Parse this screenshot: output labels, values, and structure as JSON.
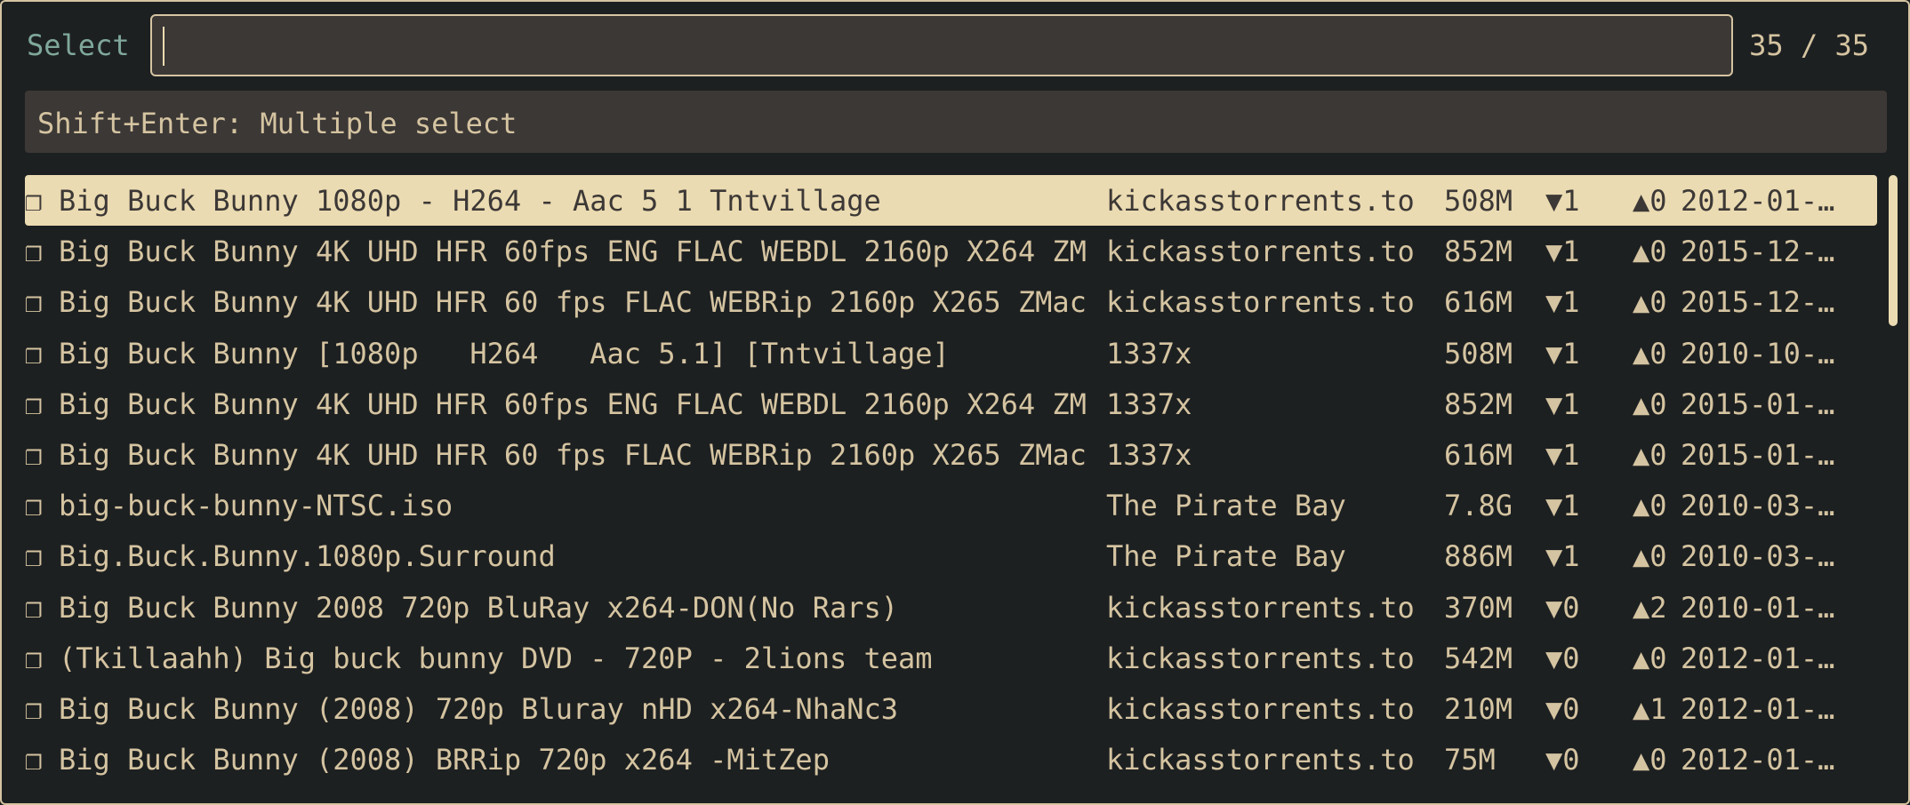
{
  "prompt": {
    "label": "Select",
    "value": "",
    "count": "35 / 35"
  },
  "header": {
    "text": "Shift+Enter: Multiple select"
  },
  "results": [
    {
      "check": "❐",
      "title": "Big Buck Bunny 1080p - H264 - Aac 5 1 Tntvillage",
      "source": "kickasstorrents.to",
      "size": "508M",
      "seeders": "▼1",
      "leechers": "▲0",
      "date": "2012-01-…",
      "selected": true
    },
    {
      "check": "❐",
      "title": "Big Buck Bunny 4K UHD HFR 60fps ENG FLAC WEBDL 2160p X264 ZM",
      "source": "kickasstorrents.to",
      "size": "852M",
      "seeders": "▼1",
      "leechers": "▲0",
      "date": "2015-12-…",
      "selected": false
    },
    {
      "check": "❐",
      "title": "Big Buck Bunny 4K UHD HFR 60 fps FLAC WEBRip 2160p X265 ZMac",
      "source": "kickasstorrents.to",
      "size": "616M",
      "seeders": "▼1",
      "leechers": "▲0",
      "date": "2015-12-…",
      "selected": false
    },
    {
      "check": "❐",
      "title": "Big Buck Bunny [1080p   H264   Aac 5.1] [Tntvillage]",
      "source": "1337x",
      "size": "508M",
      "seeders": "▼1",
      "leechers": "▲0",
      "date": "2010-10-…",
      "selected": false
    },
    {
      "check": "❐",
      "title": "Big Buck Bunny 4K UHD HFR 60fps ENG FLAC WEBDL 2160p X264 ZM",
      "source": "1337x",
      "size": "852M",
      "seeders": "▼1",
      "leechers": "▲0",
      "date": "2015-01-…",
      "selected": false
    },
    {
      "check": "❐",
      "title": "Big Buck Bunny 4K UHD HFR 60 fps FLAC WEBRip 2160p X265 ZMac",
      "source": "1337x",
      "size": "616M",
      "seeders": "▼1",
      "leechers": "▲0",
      "date": "2015-01-…",
      "selected": false
    },
    {
      "check": "❐",
      "title": "big-buck-bunny-NTSC.iso",
      "source": "The Pirate Bay",
      "size": "7.8G",
      "seeders": "▼1",
      "leechers": "▲0",
      "date": "2010-03-…",
      "selected": false
    },
    {
      "check": "❐",
      "title": "Big.Buck.Bunny.1080p.Surround",
      "source": "The Pirate Bay",
      "size": "886M",
      "seeders": "▼1",
      "leechers": "▲0",
      "date": "2010-03-…",
      "selected": false
    },
    {
      "check": "❐",
      "title": "Big Buck Bunny 2008 720p BluRay x264-DON(No Rars)",
      "source": "kickasstorrents.to",
      "size": "370M",
      "seeders": "▼0",
      "leechers": "▲2",
      "date": "2010-01-…",
      "selected": false
    },
    {
      "check": "❐",
      "title": "(Tkillaahh) Big buck bunny DVD - 720P - 2lions team",
      "source": "kickasstorrents.to",
      "size": "542M",
      "seeders": "▼0",
      "leechers": "▲0",
      "date": "2012-01-…",
      "selected": false
    },
    {
      "check": "❐",
      "title": "Big Buck Bunny (2008) 720p Bluray nHD x264-NhaNc3",
      "source": "kickasstorrents.to",
      "size": "210M",
      "seeders": "▼0",
      "leechers": "▲1",
      "date": "2012-01-…",
      "selected": false
    },
    {
      "check": "❐",
      "title": "Big Buck Bunny (2008) BRRip 720p x264 -MitZep",
      "source": "kickasstorrents.to",
      "size": "75M",
      "seeders": "▼0",
      "leechers": "▲0",
      "date": "2012-01-…",
      "selected": false
    }
  ],
  "colors": {
    "background": "#1d2021",
    "foreground": "#d5c4a1",
    "prompt_label": "#7fa89a",
    "input_background": "#3c3836",
    "selected_background": "#ebdbb2",
    "selected_foreground": "#3c3836"
  }
}
